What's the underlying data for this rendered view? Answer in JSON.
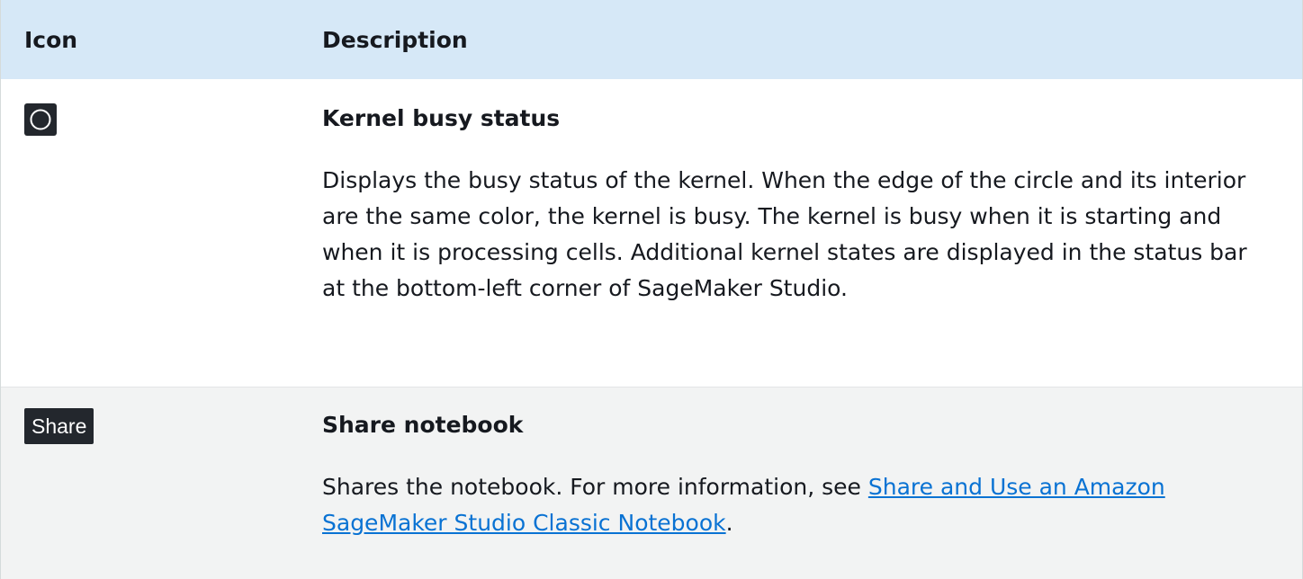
{
  "header": {
    "icon_col": "Icon",
    "description_col": "Description"
  },
  "rows": [
    {
      "icon": "circle-outline-icon",
      "title": "Kernel busy status",
      "body": "Displays the busy status of the kernel. When the edge of the circle and its interior are the same color, the kernel is busy. The kernel is busy when it is starting and when it is processing cells. Additional kernel states are displayed in the status bar at the bottom-left corner of SageMaker Studio."
    },
    {
      "icon_label": "Share",
      "title": "Share notebook",
      "body_prefix": "Shares the notebook. For more information, see ",
      "link_text": "Share and Use an Amazon SageMaker Studio Classic Notebook",
      "body_suffix": "."
    }
  ],
  "colors": {
    "header_bg": "#d6e8f7",
    "row_alt_bg": "#f2f3f3",
    "icon_bg": "#23272d",
    "link": "#0972d3"
  }
}
